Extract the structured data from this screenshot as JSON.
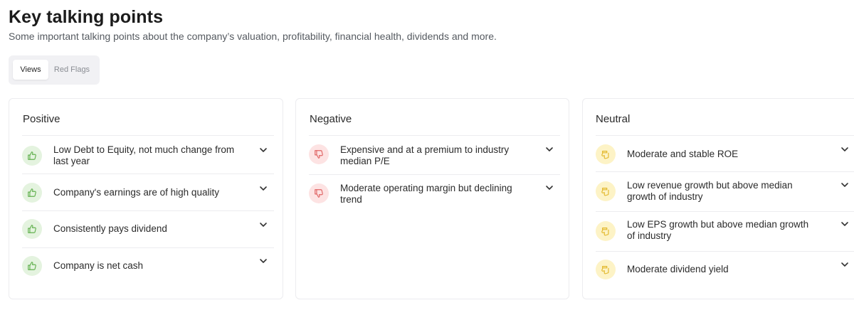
{
  "header": {
    "title": "Key talking points",
    "subtitle": "Some important talking points about the company’s valuation, profitability, financial health, dividends and more."
  },
  "tabs": [
    {
      "label": "Views",
      "active": true
    },
    {
      "label": "Red Flags",
      "active": false
    }
  ],
  "colors": {
    "positive_bg": "#e4f3df",
    "positive_fg": "#62b14f",
    "negative_bg": "#fde3e3",
    "negative_fg": "#e06464",
    "neutral_bg": "#fdf3c6",
    "neutral_fg": "#e2b72a"
  },
  "positive": {
    "heading": "Positive",
    "icon": "thumbs-up-icon",
    "items": [
      {
        "text": "Low Debt to Equity, not much change from last year"
      },
      {
        "text": "Company's earnings are of high quality"
      },
      {
        "text": "Consistently pays dividend"
      },
      {
        "text": "Company is net cash"
      }
    ]
  },
  "negative": {
    "heading": "Negative",
    "icon": "thumbs-down-icon",
    "items": [
      {
        "text": "Expensive and at a premium to industry median P/E"
      },
      {
        "text": "Moderate operating margin but declining trend"
      }
    ]
  },
  "neutral": {
    "heading": "Neutral",
    "icon": "thumbs-sideways-icon",
    "items": [
      {
        "text": "Moderate and stable ROE"
      },
      {
        "text": "Low revenue growth but above median growth of industry"
      },
      {
        "text": "Low EPS growth but above median growth of industry"
      },
      {
        "text": "Moderate dividend yield"
      }
    ]
  }
}
